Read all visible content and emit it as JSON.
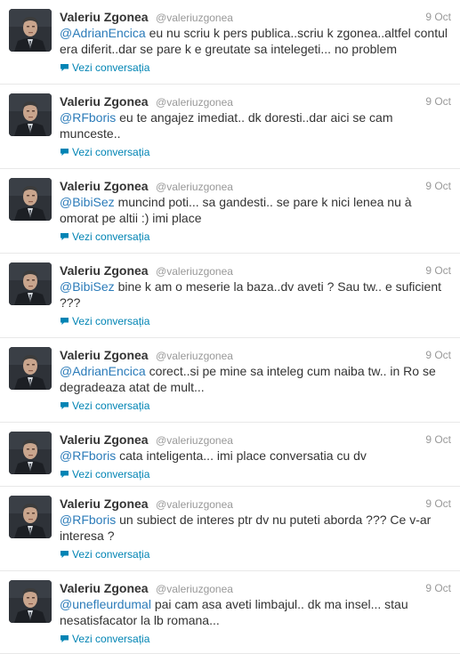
{
  "conversation_label": "Vezi conversația",
  "colors": {
    "mention": "#2b7bb9",
    "link": "#0084b4",
    "meta": "#999999",
    "text": "#333333"
  },
  "tweets": [
    {
      "name": "Valeriu Zgonea",
      "handle": "@valeriuzgonea",
      "time": "9 Oct",
      "mention": "@AdrianEncica",
      "text": " eu nu scriu k pers publica..scriu k zgonea..altfel contul era diferit..dar se pare k e greutate sa intelegeti... no problem"
    },
    {
      "name": "Valeriu Zgonea",
      "handle": "@valeriuzgonea",
      "time": "9 Oct",
      "mention": "@RFboris",
      "text": " eu te angajez imediat.. dk doresti..dar aici se cam munceste.."
    },
    {
      "name": "Valeriu Zgonea",
      "handle": "@valeriuzgonea",
      "time": "9 Oct",
      "mention": "@BibiSez",
      "text": " muncind poti... sa gandesti.. se pare k nici lenea nu à omorat pe altii :) imi place"
    },
    {
      "name": "Valeriu Zgonea",
      "handle": "@valeriuzgonea",
      "time": "9 Oct",
      "mention": "@BibiSez",
      "text": " bine k am o meserie la baza..dv aveti ? Sau tw.. e suficient ???"
    },
    {
      "name": "Valeriu Zgonea",
      "handle": "@valeriuzgonea",
      "time": "9 Oct",
      "mention": "@AdrianEncica",
      "text": " corect..si pe mine sa inteleg cum naiba tw.. in Ro se degradeaza atat de mult..."
    },
    {
      "name": "Valeriu Zgonea",
      "handle": "@valeriuzgonea",
      "time": "9 Oct",
      "mention": "@RFboris",
      "text": " cata inteligenta... imi place conversatia cu dv"
    },
    {
      "name": "Valeriu Zgonea",
      "handle": "@valeriuzgonea",
      "time": "9 Oct",
      "mention": "@RFboris",
      "text": " un subiect de interes ptr dv nu puteti aborda ??? Ce v-ar interesa ?"
    },
    {
      "name": "Valeriu Zgonea",
      "handle": "@valeriuzgonea",
      "time": "9 Oct",
      "mention": "@unefleurdumal",
      "text": " pai cam asa aveti limbajul.. dk ma insel... stau nesatisfacator la lb romana..."
    }
  ]
}
